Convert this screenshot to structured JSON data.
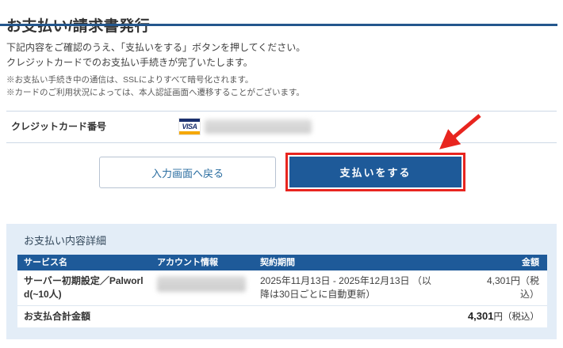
{
  "page": {
    "title": "お支払い/請求書発行",
    "intro_lines": [
      "下記内容をご確認のうえ、「支払いをする」ボタンを押してください。",
      "クレジットカードでのお支払い手続きが完了いたします。"
    ],
    "notes": [
      "※お支払い手続き中の通信は、SSLによりすべて暗号化されます。",
      "※カードのご利用状況によっては、本人認証画面へ遷移することがございます。"
    ]
  },
  "card_section": {
    "label": "クレジットカード番号",
    "brand": "VISA",
    "number_state": "blurred"
  },
  "actions": {
    "back_label": "入力画面へ戻る",
    "pay_label": "支払いをする"
  },
  "details": {
    "title": "お支払い内容詳細",
    "columns": [
      "サービス名",
      "アカウント情報",
      "契約期間",
      "金額"
    ],
    "rows": [
      {
        "service": "サーバー初期設定／Palworld(~10人)",
        "account_state": "blurred",
        "period": "2025年11月13日 - 2025年12月13日 （以降は30日ごとに自動更新）",
        "amount": "4,301円（税込）"
      }
    ],
    "total_label": "お支払合計金額",
    "total_amount": "4,301",
    "total_suffix": "円（税込）"
  },
  "colors": {
    "accent_blue": "#1e5a99",
    "title_rule_blue": "#24578d",
    "panel_background": "#e3edf7",
    "highlight_red": "#e8251f",
    "visa_navy": "#1a2f6e",
    "visa_gold": "#f5a800"
  }
}
